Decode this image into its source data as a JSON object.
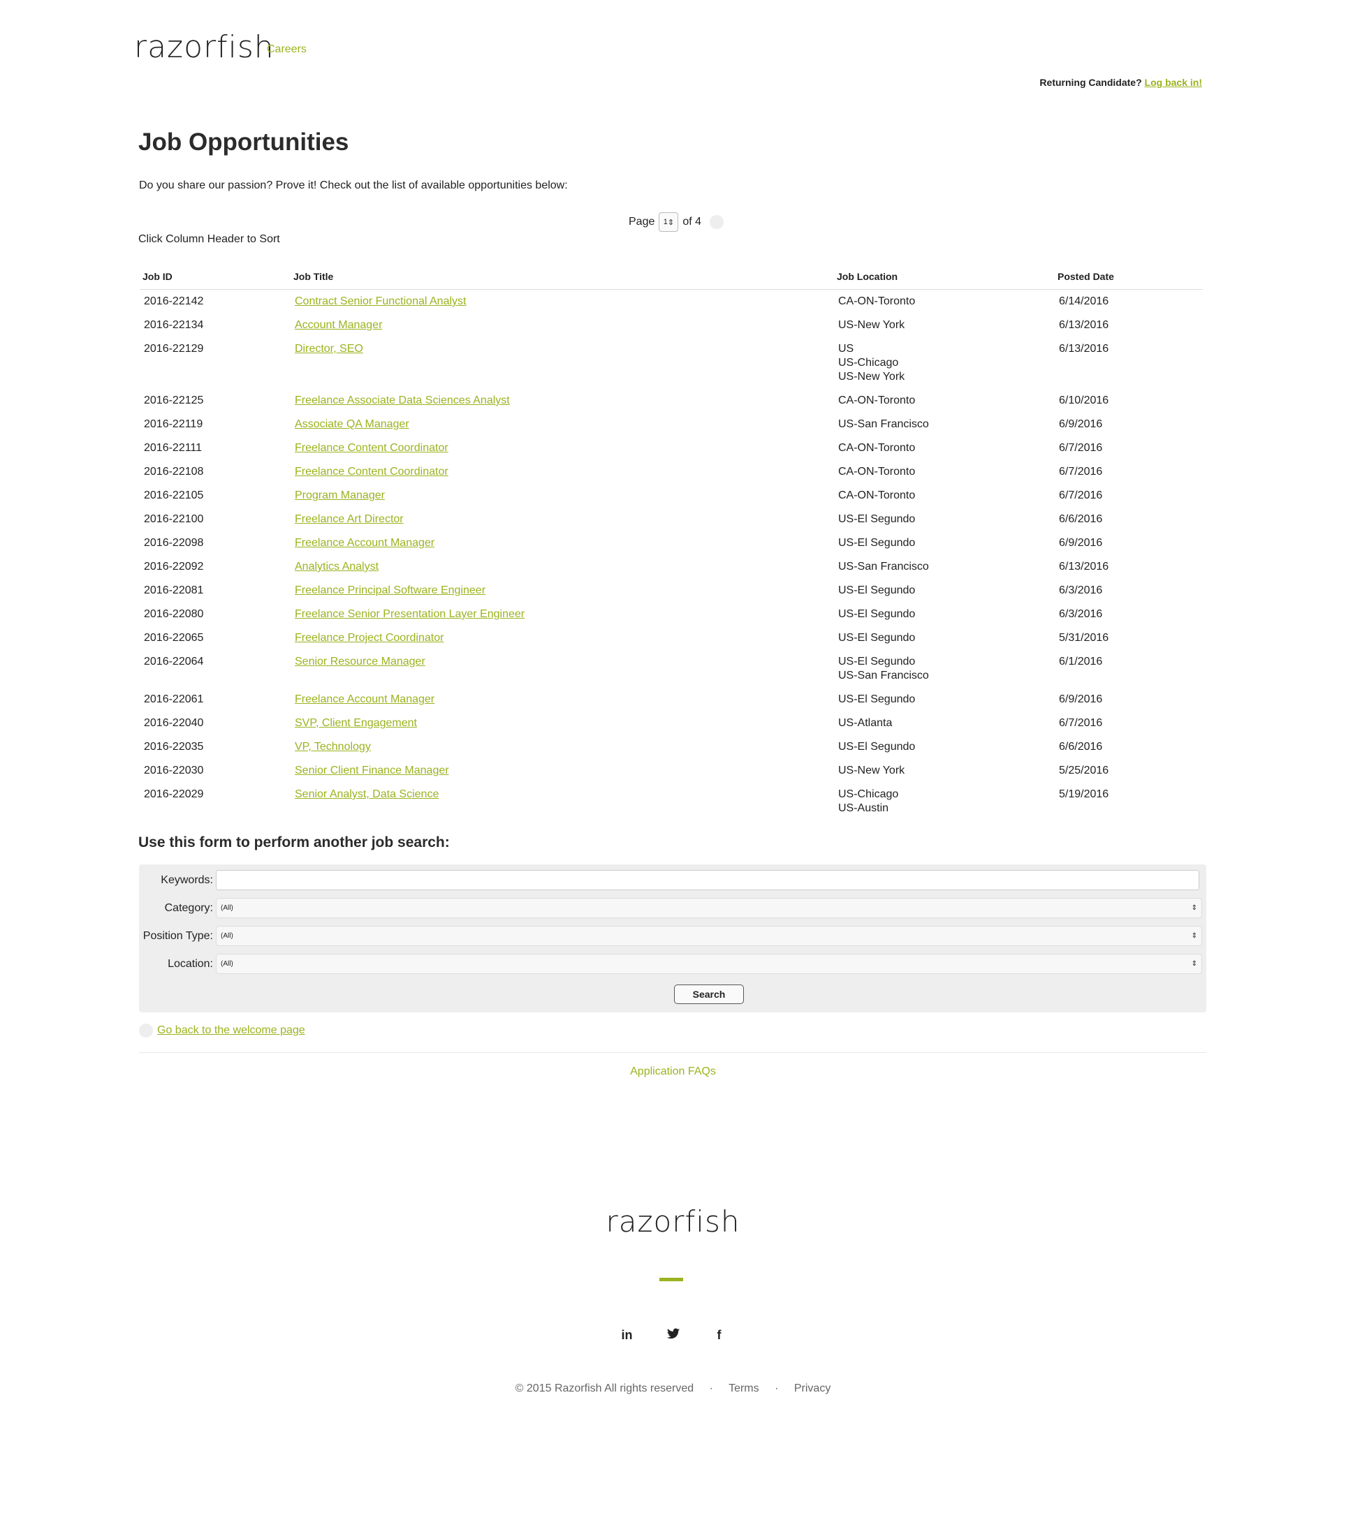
{
  "header": {
    "logo": "razorfish",
    "careers_link": "Careers",
    "returning_text": "Returning Candidate?",
    "login_link": "Log back in!"
  },
  "main": {
    "title": "Job Opportunities",
    "intro": "Do you share our passion? Prove it! Check out the list of available opportunities below:",
    "pager": {
      "page_label": "Page",
      "page_value": "1",
      "of_label": "of 4"
    },
    "sort_hint": "Click Column Header to Sort",
    "columns": [
      "Job ID",
      "Job Title",
      "Job Location",
      "Posted Date"
    ],
    "jobs": [
      {
        "id": "2016-22142",
        "title": "Contract Senior Functional Analyst",
        "locations": [
          "CA-ON-Toronto"
        ],
        "date": "6/14/2016"
      },
      {
        "id": "2016-22134",
        "title": "Account Manager",
        "locations": [
          "US-New York"
        ],
        "date": "6/13/2016"
      },
      {
        "id": "2016-22129",
        "title": "Director, SEO",
        "locations": [
          "US",
          "US-Chicago",
          "US-New York"
        ],
        "date": "6/13/2016"
      },
      {
        "id": "2016-22125",
        "title": "Freelance Associate Data Sciences Analyst",
        "locations": [
          "CA-ON-Toronto"
        ],
        "date": "6/10/2016"
      },
      {
        "id": "2016-22119",
        "title": "Associate QA Manager",
        "locations": [
          "US-San Francisco"
        ],
        "date": "6/9/2016"
      },
      {
        "id": "2016-22111",
        "title": "Freelance Content Coordinator",
        "locations": [
          "CA-ON-Toronto"
        ],
        "date": "6/7/2016"
      },
      {
        "id": "2016-22108",
        "title": "Freelance Content Coordinator",
        "locations": [
          "CA-ON-Toronto"
        ],
        "date": "6/7/2016"
      },
      {
        "id": "2016-22105",
        "title": "Program Manager",
        "locations": [
          "CA-ON-Toronto"
        ],
        "date": "6/7/2016"
      },
      {
        "id": "2016-22100",
        "title": "Freelance Art Director",
        "locations": [
          "US-El Segundo"
        ],
        "date": "6/6/2016"
      },
      {
        "id": "2016-22098",
        "title": "Freelance Account Manager",
        "locations": [
          "US-El Segundo"
        ],
        "date": "6/9/2016"
      },
      {
        "id": "2016-22092",
        "title": "Analytics Analyst",
        "locations": [
          "US-San Francisco"
        ],
        "date": "6/13/2016"
      },
      {
        "id": "2016-22081",
        "title": "Freelance Principal Software Engineer",
        "locations": [
          "US-El Segundo"
        ],
        "date": "6/3/2016"
      },
      {
        "id": "2016-22080",
        "title": "Freelance Senior Presentation Layer Engineer",
        "locations": [
          "US-El Segundo"
        ],
        "date": "6/3/2016"
      },
      {
        "id": "2016-22065",
        "title": "Freelance Project Coordinator",
        "locations": [
          "US-El Segundo"
        ],
        "date": "5/31/2016"
      },
      {
        "id": "2016-22064",
        "title": "Senior Resource Manager",
        "locations": [
          "US-El Segundo",
          "US-San Francisco"
        ],
        "date": "6/1/2016"
      },
      {
        "id": "2016-22061",
        "title": "Freelance Account Manager",
        "locations": [
          "US-El Segundo"
        ],
        "date": "6/9/2016"
      },
      {
        "id": "2016-22040",
        "title": "SVP, Client Engagement",
        "locations": [
          "US-Atlanta"
        ],
        "date": "6/7/2016"
      },
      {
        "id": "2016-22035",
        "title": "VP, Technology",
        "locations": [
          "US-El Segundo"
        ],
        "date": "6/6/2016"
      },
      {
        "id": "2016-22030",
        "title": "Senior Client Finance Manager",
        "locations": [
          "US-New York"
        ],
        "date": "5/25/2016"
      },
      {
        "id": "2016-22029",
        "title": "Senior Analyst, Data Science",
        "locations": [
          "US-Chicago",
          "US-Austin"
        ],
        "date": "5/19/2016"
      }
    ]
  },
  "search": {
    "heading": "Use this form to perform another job search:",
    "keywords_label": "Keywords:",
    "keywords_value": "",
    "category_label": "Category:",
    "category_value": "(All)",
    "position_type_label": "Position Type:",
    "position_type_value": "(All)",
    "location_label": "Location:",
    "location_value": "(All)",
    "search_button": "Search"
  },
  "links": {
    "back": "Go back to the welcome page",
    "faq": "Application FAQs"
  },
  "footer": {
    "logo": "razorfish",
    "social_icons": [
      "linkedin-icon",
      "twitter-icon",
      "facebook-icon"
    ],
    "linkedin_glyph": "in",
    "twitter_glyph": "🐦",
    "facebook_glyph": "f",
    "copyright": "© 2015 Razorfish All rights reserved",
    "separator": "·",
    "terms": "Terms",
    "privacy": "Privacy"
  },
  "colors": {
    "accent": "#9bb31f",
    "text": "#222222",
    "panel": "#eeeeee"
  }
}
